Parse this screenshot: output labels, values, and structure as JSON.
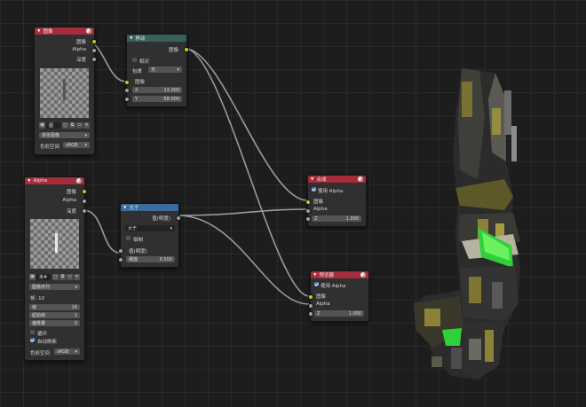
{
  "nodes": {
    "image": {
      "title": "图像",
      "outputs": [
        "图像",
        "Alpha",
        "深度"
      ],
      "image_name": "图",
      "source": "单张图像",
      "colorspace_label": "色彩空间",
      "colorspace_value": "sRGB"
    },
    "translate": {
      "title": "移动",
      "output": "图像",
      "relative_label": "相对",
      "wrap_label": "包裹",
      "wrap_value": "无",
      "input": "图像",
      "x_label": "X",
      "x_value": "13.000",
      "y_label": "Y",
      "y_value": "-58.000"
    },
    "alpha": {
      "title": "Alpha",
      "outputs": [
        "图像",
        "Alpha",
        "深度"
      ],
      "image_name": "未#",
      "source": "图像序列",
      "frames_label": "帧: 10",
      "frames_field_label": "帧",
      "frames_field_value": "14",
      "start_label": "起始帧",
      "start_value": "1",
      "offset_label": "偏移量",
      "offset_value": "0",
      "cyclic_label": "循环",
      "autorefresh_label": "自动刷新",
      "colorspace_label": "色彩空间",
      "colorspace_value": "sRGB"
    },
    "greater": {
      "title": "大于",
      "output": "值(明度)",
      "op_value": "大于",
      "clamp_label": "钳制",
      "input": "值(明度)",
      "threshold_label": "阈值",
      "threshold_value": "0.500"
    },
    "composite": {
      "title": "合成",
      "use_alpha_label": "使用 Alpha",
      "in_image": "图像",
      "in_alpha": "Alpha",
      "z_label": "Z",
      "z_value": "1.000"
    },
    "viewer": {
      "title": "预览器",
      "use_alpha_label": "使用 Alpha",
      "in_image": "图像",
      "in_alpha": "Alpha",
      "z_label": "Z",
      "z_value": "1.000"
    }
  },
  "colors": {
    "input_header": "#a52c3b",
    "distort_header": "#395f5b",
    "converter_header": "#3a6d9c",
    "color_socket": "#c7c729",
    "value_socket": "#a1a1a1",
    "backdrop_green": "#2fd13a",
    "backdrop_gold": "#8a8236"
  },
  "icons": [
    "collapse-arrow-icon",
    "globe-icon",
    "image-icon",
    "folder-icon",
    "close-icon",
    "checkbox-icon"
  ]
}
